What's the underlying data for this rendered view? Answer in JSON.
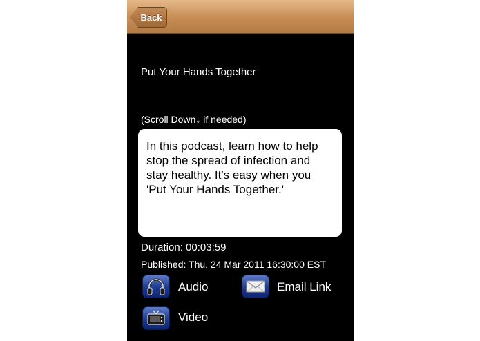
{
  "navbar": {
    "back_label": "Back"
  },
  "podcast": {
    "title": "Put Your Hands Together",
    "scroll_hint": "(Scroll Down↓  if needed)",
    "description": "In this podcast, learn how to help stop the spread of infection and stay healthy. It's easy when you 'Put Your Hands Together.'",
    "duration": "Duration: 00:03:59",
    "published": "Published: Thu, 24 Mar 2011 16:30:00 EST"
  },
  "actions": {
    "audio_label": "Audio",
    "email_label": "Email Link",
    "video_label": "Video"
  },
  "colors": {
    "navbar": "#c98f57",
    "background": "#000000",
    "button_blue": "#1d3b8f"
  },
  "icons": [
    "headphones-icon",
    "envelope-icon",
    "tv-icon"
  ]
}
